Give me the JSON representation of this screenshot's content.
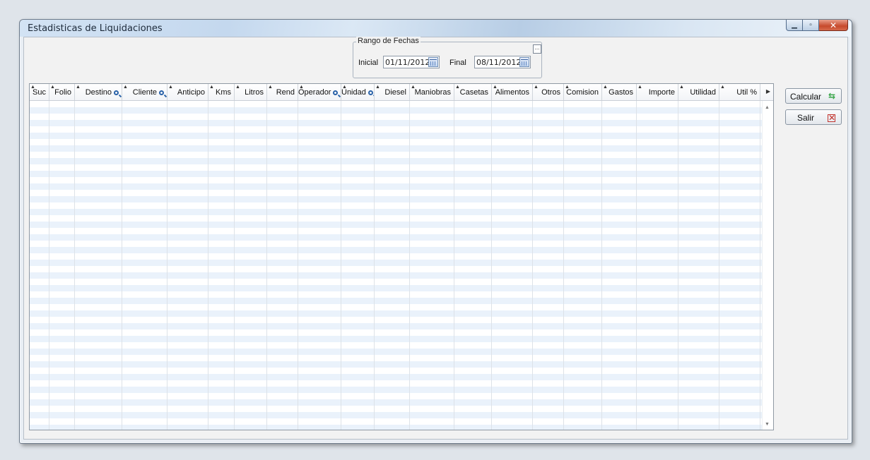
{
  "window": {
    "title": "Estadisticas de Liquidaciones",
    "controls": {
      "minimize": "▁",
      "maximize": "▫",
      "close": "✕"
    }
  },
  "date_range": {
    "group_label": "Rango de Fechas",
    "ellipsis": "...",
    "start_label": "Inicial",
    "start_value": "01/11/2012",
    "end_label": "Final",
    "end_value": "08/11/2012"
  },
  "table": {
    "columns": [
      {
        "label": "Suc",
        "search": false
      },
      {
        "label": "Folio",
        "search": false
      },
      {
        "label": "Destino",
        "search": true
      },
      {
        "label": "Cliente",
        "search": true
      },
      {
        "label": "Anticipo",
        "search": false
      },
      {
        "label": "Kms",
        "search": false
      },
      {
        "label": "Litros",
        "search": false
      },
      {
        "label": "Rend",
        "search": false
      },
      {
        "label": "Operador",
        "search": true
      },
      {
        "label": "Unidad",
        "search": true
      },
      {
        "label": "Diesel",
        "search": false
      },
      {
        "label": "Maniobras",
        "search": false
      },
      {
        "label": "Casetas",
        "search": false
      },
      {
        "label": "Alimentos",
        "search": false
      },
      {
        "label": "Otros",
        "search": false
      },
      {
        "label": "Comision",
        "search": false
      },
      {
        "label": "Gastos",
        "search": false
      },
      {
        "label": "Importe",
        "search": false
      },
      {
        "label": "Utilidad",
        "search": false
      },
      {
        "label": "Util %",
        "search": false
      }
    ],
    "rows": []
  },
  "buttons": {
    "calcular": "Calcular",
    "salir": "Salir"
  },
  "icons": {
    "calendar": "calendar-icon",
    "search": "search-icon",
    "refresh": "refresh-icon",
    "close": "close-icon"
  }
}
